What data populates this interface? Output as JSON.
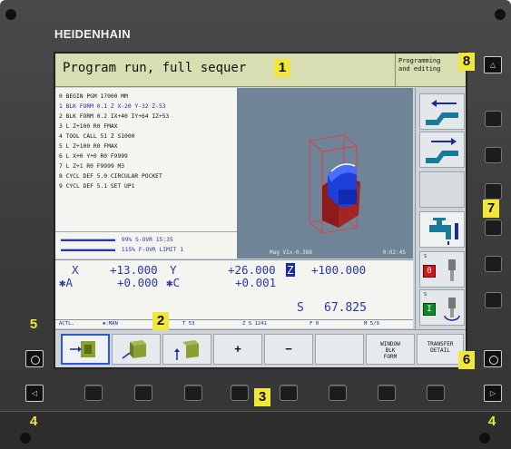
{
  "brand": "HEIDENHAIN",
  "header": {
    "mode": "Program run, full sequer",
    "second_mode": "Programming\nand editing"
  },
  "program": {
    "lines": [
      "0  BEGIN PGM 17000 MM",
      "1  BLK FORM 0.1 Z  X-20  Y-32  Z-53",
      "2  BLK FORM 0.2 IX+40 IY+64 IZ+53",
      "3  L  Z+100 R0 FMAX",
      "4  TOOL CALL 51 Z S1000",
      "5  L  Z+100 R0 FMAX",
      "6  L  X+0  Y+0 R0 F9999",
      "7  L  Z+1 R0 F9999 M3",
      "8  CYCL DEF 5.0 CIRCULAR POCKET",
      "9  CYCL DEF 5.1 SET UP1"
    ],
    "active_line_index": 1
  },
  "graphic": {
    "status": "Mag V1x-0.388",
    "time": "0:02:45"
  },
  "overrides": {
    "spindle": "99% S-OVR 15:35",
    "feed": "115% F-OVR LIMIT 1"
  },
  "positions": {
    "row1_x_label": "X",
    "row1_x_value": "+13.000",
    "row1_y_label": "Y",
    "row1_y_value": "+26.000",
    "row1_z_label": "Z",
    "row1_z_value": "+100.000",
    "row2_a_label": "✱A",
    "row2_a_value": "+0.000",
    "row2_c_label": "✱C",
    "row2_c_value": "+0.001",
    "spindle_label": "S",
    "spindle_value": "67.825"
  },
  "status_bar": {
    "mode": "ACTL.",
    "tool_axis": "✱:MAN",
    "t": "T 53",
    "z_s": "Z S 1241",
    "f": "F 0",
    "m": "M 5/9"
  },
  "vertical_softkeys": {
    "key5_label": "S",
    "key5_state": "0",
    "key6_label": "S",
    "key6_state": "I"
  },
  "horizontal_softkeys": {
    "plus": "+",
    "minus": "−",
    "window_blk_form": "WINDOW\nBLK\nFORM",
    "transfer_detail": "TRANSFER\nDETAIL"
  },
  "callouts": {
    "c1": "1",
    "c2": "2",
    "c3": "3",
    "c4_left": "4",
    "c4_right": "4",
    "c5": "5",
    "c6": "6",
    "c7": "7",
    "c8": "8"
  },
  "colors": {
    "header_bg": "#d9ddb2",
    "accent_blue": "#2a38a8",
    "callout_yellow": "#f1e63a",
    "red_state": "#d01818",
    "green_state": "#0a8a2a"
  }
}
